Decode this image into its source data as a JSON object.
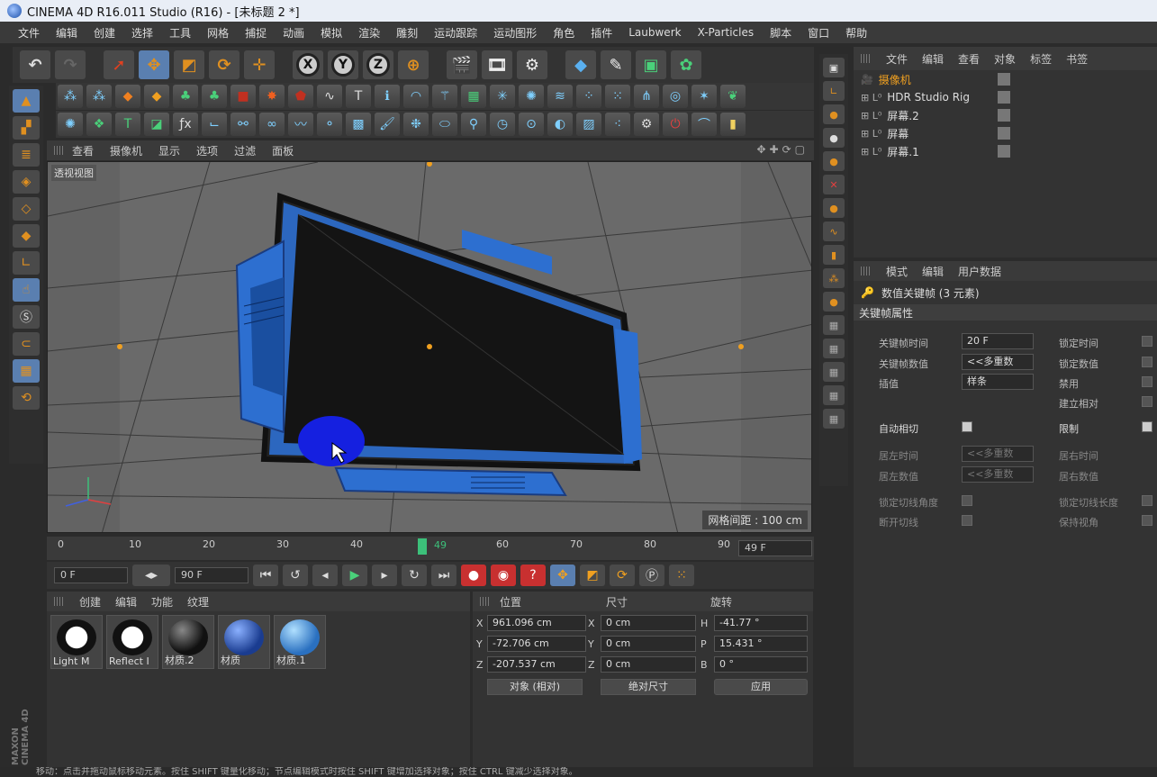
{
  "app": {
    "title": "CINEMA 4D R16.011 Studio (R16) - [未标题 2 *]"
  },
  "menu": [
    "文件",
    "编辑",
    "创建",
    "选择",
    "工具",
    "网格",
    "捕捉",
    "动画",
    "模拟",
    "渲染",
    "雕刻",
    "运动跟踪",
    "运动图形",
    "角色",
    "插件",
    "Laubwerk",
    "X-Particles",
    "脚本",
    "窗口",
    "帮助"
  ],
  "viewport": {
    "menu": [
      "查看",
      "摄像机",
      "显示",
      "选项",
      "过滤",
      "面板"
    ],
    "label": "透视视图",
    "grid_distance": "网格间距 : 100 cm"
  },
  "timeline": {
    "ticks": [
      "0",
      "10",
      "20",
      "30",
      "40",
      "49",
      "60",
      "70",
      "80",
      "90"
    ],
    "current_frame": "49 F"
  },
  "transport": {
    "start": "0 F",
    "end": "90 F"
  },
  "materials": {
    "menu": [
      "创建",
      "编辑",
      "功能",
      "纹理"
    ],
    "items": [
      {
        "name": "Light M",
        "color": "#f0f0f0"
      },
      {
        "name": "Reflect I",
        "color": "#f0f0f0"
      },
      {
        "name": "材质.2",
        "color": "#1a1a1a"
      },
      {
        "name": "材质",
        "color": "#2a5ab0"
      },
      {
        "name": "材质.1",
        "color": "#4aa0e0"
      }
    ]
  },
  "coords": {
    "headers": [
      "位置",
      "尺寸",
      "旋转"
    ],
    "rows": [
      {
        "axis": "X",
        "pos": "961.096 cm",
        "size_axis": "X",
        "size": "0 cm",
        "rot_axis": "H",
        "rot": "-41.77 °"
      },
      {
        "axis": "Y",
        "pos": "-72.706 cm",
        "size_axis": "Y",
        "size": "0 cm",
        "rot_axis": "P",
        "rot": "15.431 °"
      },
      {
        "axis": "Z",
        "pos": "-207.537 cm",
        "size_axis": "Z",
        "size": "0 cm",
        "rot_axis": "B",
        "rot": "0 °"
      }
    ],
    "mode": "对象 (相对)",
    "size_mode": "绝对尺寸",
    "apply": "应用"
  },
  "objects": {
    "menu": [
      "文件",
      "编辑",
      "查看",
      "对象",
      "标签",
      "书签"
    ],
    "items": [
      "摄像机",
      "HDR Studio Rig",
      "屏幕.2",
      "屏幕",
      "屏幕.1"
    ]
  },
  "attributes": {
    "menu": [
      "模式",
      "编辑",
      "用户数据"
    ],
    "title": "数值关键帧 (3 元素)",
    "group": "关键帧属性",
    "key_time_label": "关键帧时间",
    "key_time": "20 F",
    "key_value_label": "关键帧数值",
    "key_value": "<<多重数",
    "interp_label": "插值",
    "interp": "样条",
    "lock_time": "锁定时间",
    "lock_value": "锁定数值",
    "mute": "禁用",
    "relative": "建立相对",
    "auto_tangent": "自动相切",
    "clamp": "限制",
    "left_time": "居左时间",
    "left_value": "居左数值",
    "right_time": "居右时间",
    "right_value": "居右数值",
    "multi": "<<多重数",
    "lock_tan_angle": "锁定切线角度",
    "lock_tan_length": "锁定切线长度",
    "break_tan": "断开切线",
    "keep_visual": "保持视角"
  },
  "status": "移动：点击并拖动鼠标移动元素。按住 SHIFT 键量化移动；节点编辑模式时按住 SHIFT 键增加选择对象；按住 CTRL 键减少选择对象。",
  "brand": "MAXON CINEMA 4D"
}
